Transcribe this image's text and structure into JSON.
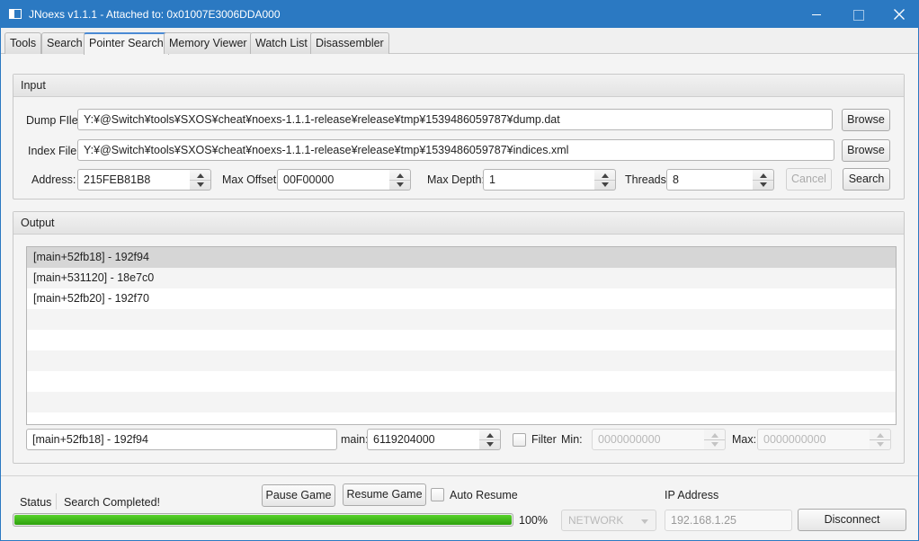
{
  "window": {
    "title": "JNoexs v1.1.1 - Attached to: 0x01007E3006DDA000"
  },
  "tabs": [
    {
      "label": "Tools"
    },
    {
      "label": "Search"
    },
    {
      "label": "Pointer Search",
      "active": true
    },
    {
      "label": "Memory Viewer"
    },
    {
      "label": "Watch List"
    },
    {
      "label": "Disassembler"
    }
  ],
  "input": {
    "header": "Input",
    "dump_file_label": "Dump FIle:",
    "dump_file_value": "Y:¥@Switch¥tools¥SXOS¥cheat¥noexs-1.1.1-release¥release¥tmp¥1539486059787¥dump.dat",
    "browse_label": "Browse",
    "index_file_label": "Index File:",
    "index_file_value": "Y:¥@Switch¥tools¥SXOS¥cheat¥noexs-1.1.1-release¥release¥tmp¥1539486059787¥indices.xml",
    "address_label": "Address:",
    "address_value": "215FEB81B8",
    "max_offset_label": "Max Offset:",
    "max_offset_value": "00F00000",
    "max_depth_label": "Max Depth:",
    "max_depth_value": "1",
    "threads_label": "Threads:",
    "threads_value": "8",
    "cancel_label": "Cancel",
    "search_label": "Search"
  },
  "output": {
    "header": "Output",
    "results": [
      {
        "text": "[main+52fb18]  - 192f94",
        "selected": true
      },
      {
        "text": "[main+531120]  - 18e7c0"
      },
      {
        "text": "[main+52fb20]  - 192f70"
      },
      {
        "text": ""
      },
      {
        "text": ""
      },
      {
        "text": ""
      },
      {
        "text": ""
      },
      {
        "text": ""
      },
      {
        "text": ""
      }
    ],
    "selected_value": "[main+52fb18]  - 192f94",
    "main_label": "main:",
    "main_value": "6119204000",
    "filter_label": "Filter",
    "min_label": "Min:",
    "min_value": "0000000000",
    "max_label": "Max:",
    "max_value": "0000000000"
  },
  "status": {
    "label": "Status",
    "text": "Search Completed!",
    "progress_percent": 100,
    "progress_text": "100%",
    "pause_game_label": "Pause Game",
    "resume_game_label": "Resume Game",
    "auto_resume_label": "Auto Resume",
    "connection_type": "NETWORK",
    "ip_address_label": "IP Address",
    "ip_address_value": "192.168.1.25",
    "disconnect_label": "Disconnect"
  },
  "colors": {
    "titlebar": "#2b79c2",
    "progress": "#3cbc18"
  }
}
